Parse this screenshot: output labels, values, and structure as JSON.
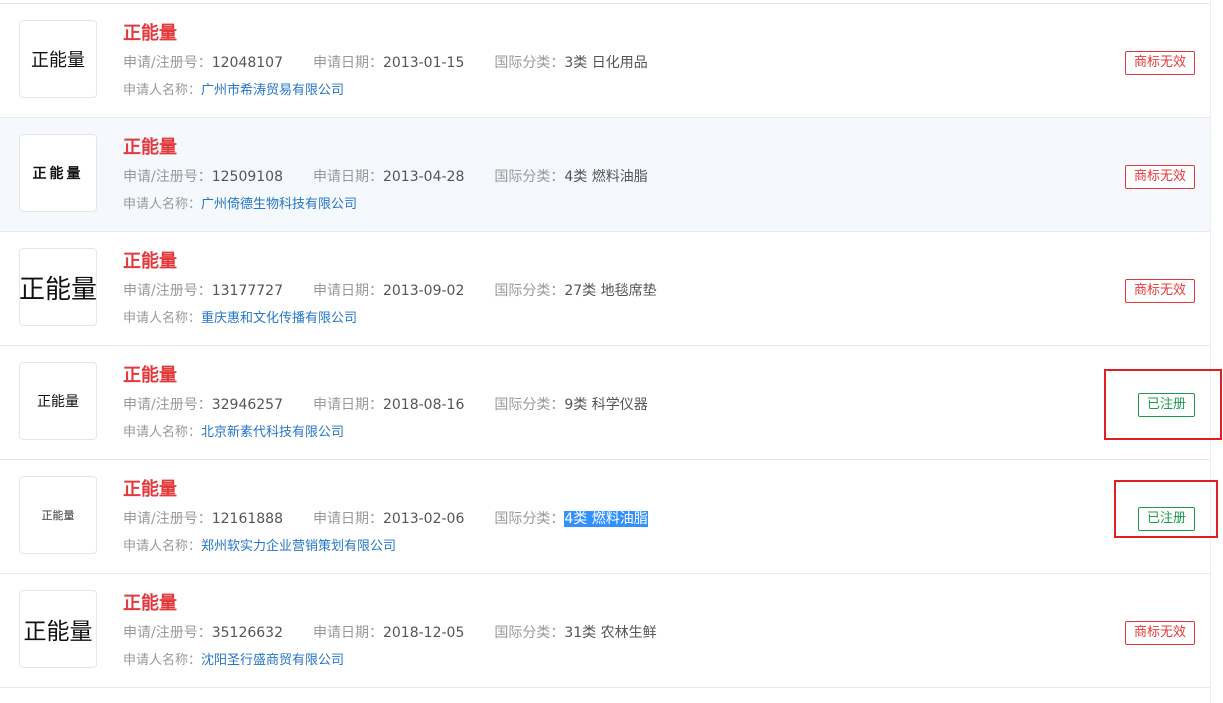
{
  "labels": {
    "reg_no": "申请/注册号：",
    "date": "申请日期：",
    "class": "国际分类：",
    "applicant": "申请人名称："
  },
  "rows": [
    {
      "logo_text": "正能量",
      "title": "正能量",
      "reg_no": "12048107",
      "date": "2013-01-15",
      "class_no": "3类",
      "class_name": "日化用品",
      "applicant": "广州市希涛贸易有限公司",
      "status": "商标无效"
    },
    {
      "logo_text": "正能量",
      "title": "正能量",
      "reg_no": "12509108",
      "date": "2013-04-28",
      "class_no": "4类",
      "class_name": "燃料油脂",
      "applicant": "广州倚德生物科技有限公司",
      "status": "商标无效"
    },
    {
      "logo_text": "正能量",
      "title": "正能量",
      "reg_no": "13177727",
      "date": "2013-09-02",
      "class_no": "27类",
      "class_name": "地毯席垫",
      "applicant": "重庆惠和文化传播有限公司",
      "status": "商标无效"
    },
    {
      "logo_text": "正能量",
      "title": "正能量",
      "reg_no": "32946257",
      "date": "2018-08-16",
      "class_no": "9类",
      "class_name": "科学仪器",
      "applicant": "北京新素代科技有限公司",
      "status": "已注册"
    },
    {
      "logo_text": "正能量",
      "title": "正能量",
      "reg_no": "12161888",
      "date": "2013-02-06",
      "class_no": "4类",
      "class_name": "燃料油脂",
      "applicant": "郑州软实力企业营销策划有限公司",
      "status": "已注册"
    },
    {
      "logo_text": "正能量",
      "title": "正能量",
      "reg_no": "35126632",
      "date": "2018-12-05",
      "class_no": "31类",
      "class_name": "农林生鲜",
      "applicant": "沈阳圣行盛商贸有限公司",
      "status": "商标无效"
    }
  ],
  "colors": {
    "title_red": "#e4393c",
    "link_blue": "#2576c7",
    "invalid_red": "#e4393c",
    "registered_green": "#1d9b4c",
    "annotation_red": "#e02020",
    "selection_blue": "#3390ff"
  }
}
